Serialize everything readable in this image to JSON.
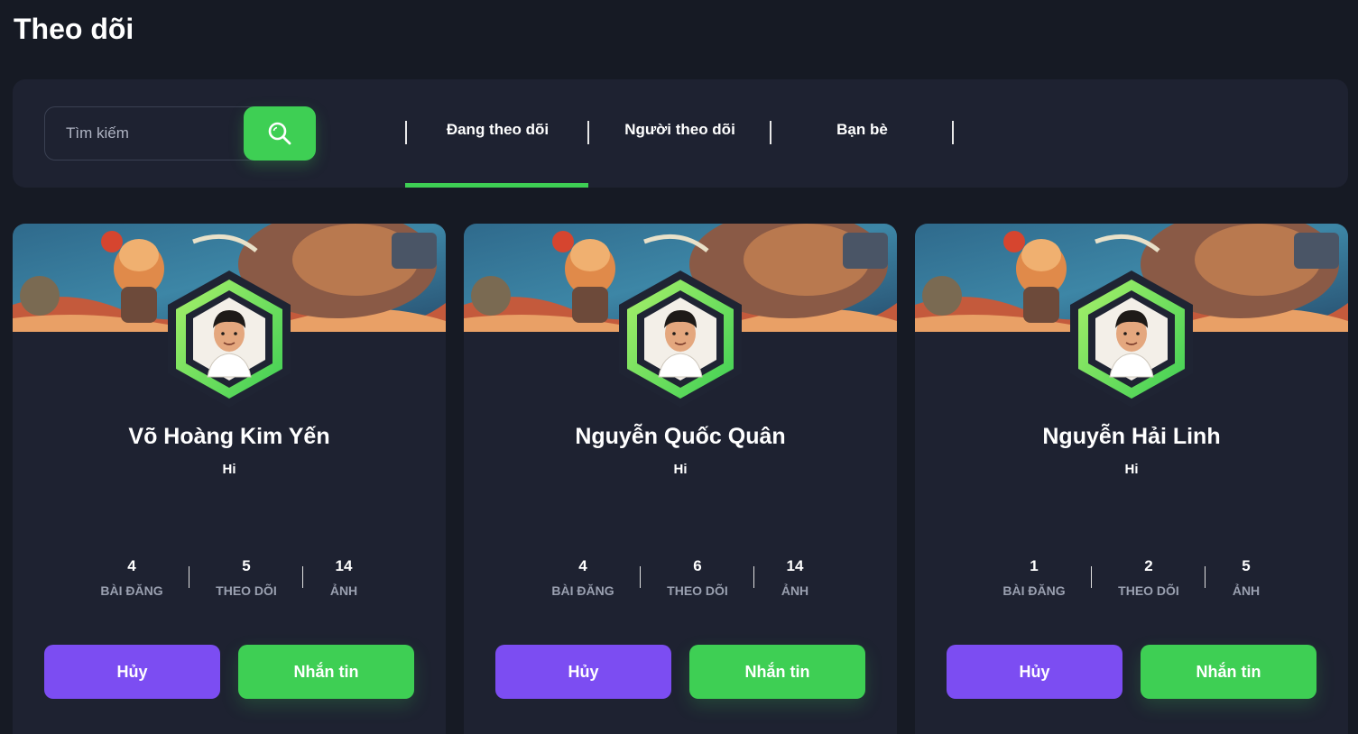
{
  "page": {
    "title": "Theo dõi"
  },
  "search": {
    "placeholder": "Tìm kiếm",
    "value": "",
    "button_icon": "search-icon"
  },
  "tabs": [
    {
      "label": "Đang theo dõi",
      "active": true
    },
    {
      "label": "Người theo dõi",
      "active": false
    },
    {
      "label": "Bạn bè",
      "active": false
    }
  ],
  "colors": {
    "accent_green": "#3ecf54",
    "accent_purple": "#7c4df2",
    "card_bg": "#1e2231",
    "page_bg": "#161a24"
  },
  "cards": [
    {
      "name": "Võ Hoàng Kim Yến",
      "bio": "Hi",
      "stats": [
        {
          "value": "4",
          "label": "BÀI ĐĂNG"
        },
        {
          "value": "5",
          "label": "THEO DÕI"
        },
        {
          "value": "14",
          "label": "ẢNH"
        }
      ],
      "cancel_label": "Hủy",
      "message_label": "Nhắn tin"
    },
    {
      "name": "Nguyễn Quốc Quân",
      "bio": "Hi",
      "stats": [
        {
          "value": "4",
          "label": "BÀI ĐĂNG"
        },
        {
          "value": "6",
          "label": "THEO DÕI"
        },
        {
          "value": "14",
          "label": "ẢNH"
        }
      ],
      "cancel_label": "Hủy",
      "message_label": "Nhắn tin"
    },
    {
      "name": "Nguyễn Hải Linh",
      "bio": "Hi",
      "stats": [
        {
          "value": "1",
          "label": "BÀI ĐĂNG"
        },
        {
          "value": "2",
          "label": "THEO DÕI"
        },
        {
          "value": "5",
          "label": "ẢNH"
        }
      ],
      "cancel_label": "Hủy",
      "message_label": "Nhắn tin"
    }
  ]
}
